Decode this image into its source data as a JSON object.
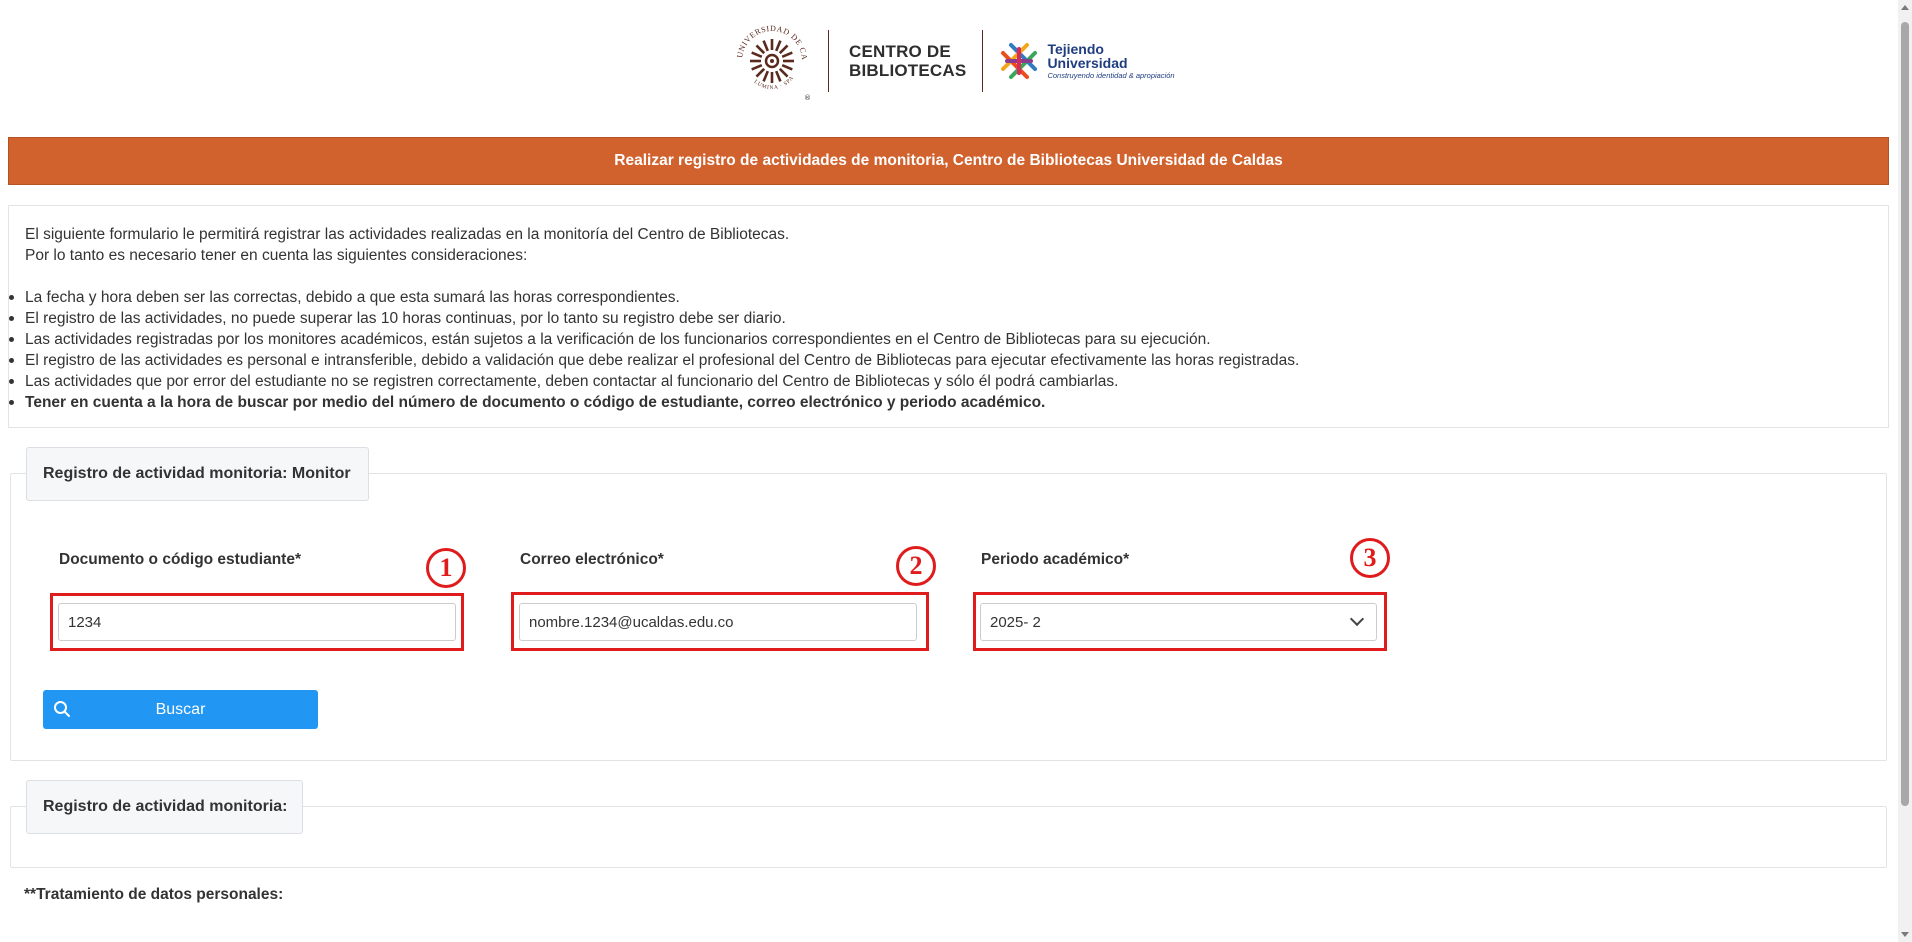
{
  "header": {
    "seal_text_top": "UNIVERSIDAD DE CALDAS",
    "seal_text_bottom": "LUMINA SPARGO",
    "cdb_line1": "CENTRO DE",
    "cdb_line2": "BIBLIOTECAS",
    "tejiendo_line1": "Tejiendo",
    "tejiendo_line2": "Universidad",
    "tejiendo_tagline": "Construyendo identidad & apropiación"
  },
  "title_bar": "Realizar registro de actividades de monitoria, Centro de Bibliotecas Universidad de Caldas",
  "info": {
    "intro1": "El siguiente formulario le permitirá registrar las actividades realizadas en la monitoría del Centro de Bibliotecas.",
    "intro2": "Por lo tanto es necesario tener en cuenta las siguientes consideraciones:",
    "bullets": [
      "La fecha y hora deben ser las correctas, debido a que esta sumará las horas correspondientes.",
      "El registro de las actividades, no puede superar las 10 horas continuas, por lo tanto su registro debe ser diario.",
      "Las actividades registradas por los monitores académicos, están sujetos a la verificación de los funcionarios correspondientes en el Centro de Bibliotecas para su ejecución.",
      "El registro de las actividades es personal e intransferible, debido a validación que debe realizar el profesional del Centro de Bibliotecas para ejecutar efectivamente las horas registradas.",
      "Las actividades que por error del estudiante no se registren correctamente, deben contactar al funcionario del Centro de Bibliotecas y sólo él podrá cambiarlas.",
      "Tener en cuenta a la hora de buscar por medio del número de documento o código de estudiante, correo electrónico y periodo académico."
    ]
  },
  "monitor_section": {
    "legend": "Registro de actividad monitoria: Monitor",
    "fields": {
      "document_label": "Documento o código estudiante*",
      "document_value": "1234",
      "email_label": "Correo electrónico*",
      "email_value": "nombre.1234@ucaldas.edu.co",
      "period_label": "Periodo académico*",
      "period_value": "2025- 2"
    },
    "search_button": "Buscar",
    "annotations": [
      "1",
      "2",
      "3"
    ],
    "highlight_color": "#e01b1b"
  },
  "activity_section": {
    "legend": "Registro de actividad monitoria:"
  },
  "privacy_heading": "**Tratamiento de datos personales:",
  "colors": {
    "title_bar": "#d2622d",
    "button": "#2196f3"
  }
}
